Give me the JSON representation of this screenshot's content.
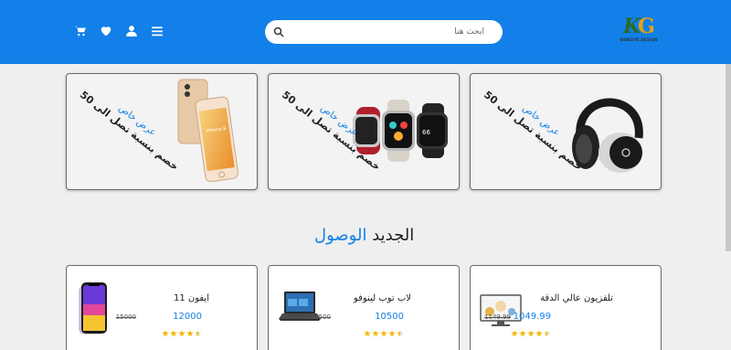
{
  "header": {
    "search_placeholder": "ابحث هنا",
    "logo_letters": "KG",
    "logo_text": "WEBSITE DESIGN",
    "icons": [
      "cart-icon",
      "heart-icon",
      "user-icon",
      "menu-icon"
    ]
  },
  "promos": [
    {
      "title": "عرض خاص",
      "desc": "خصم بنسبة تصل الى 50",
      "image": "headphones"
    },
    {
      "title": "عرض خاص",
      "desc": "خصم بنسبة تصل الى 50",
      "image": "smartwatches"
    },
    {
      "title": "عرض خاص",
      "desc": "خصم بنسبة تصل الى 50",
      "image": "iphone-8"
    }
  ],
  "section": {
    "title_dark": "الجديد",
    "title_blue": "الوصول"
  },
  "products": [
    {
      "name": "تلفزيون عالي الدقة",
      "price": "1049.99",
      "old_price": "1149.99",
      "rating": 4.5,
      "image": "tv"
    },
    {
      "name": "لاب توب لينوفو",
      "price": "10500",
      "old_price": "11500",
      "rating": 4.5,
      "image": "laptop"
    },
    {
      "name": "ايفون 11",
      "price": "12000",
      "old_price": "15000",
      "rating": 4.5,
      "image": "iphone-11"
    }
  ],
  "colors": {
    "brand": "#1280e8",
    "star": "#f2b600",
    "background": "#efefef"
  }
}
